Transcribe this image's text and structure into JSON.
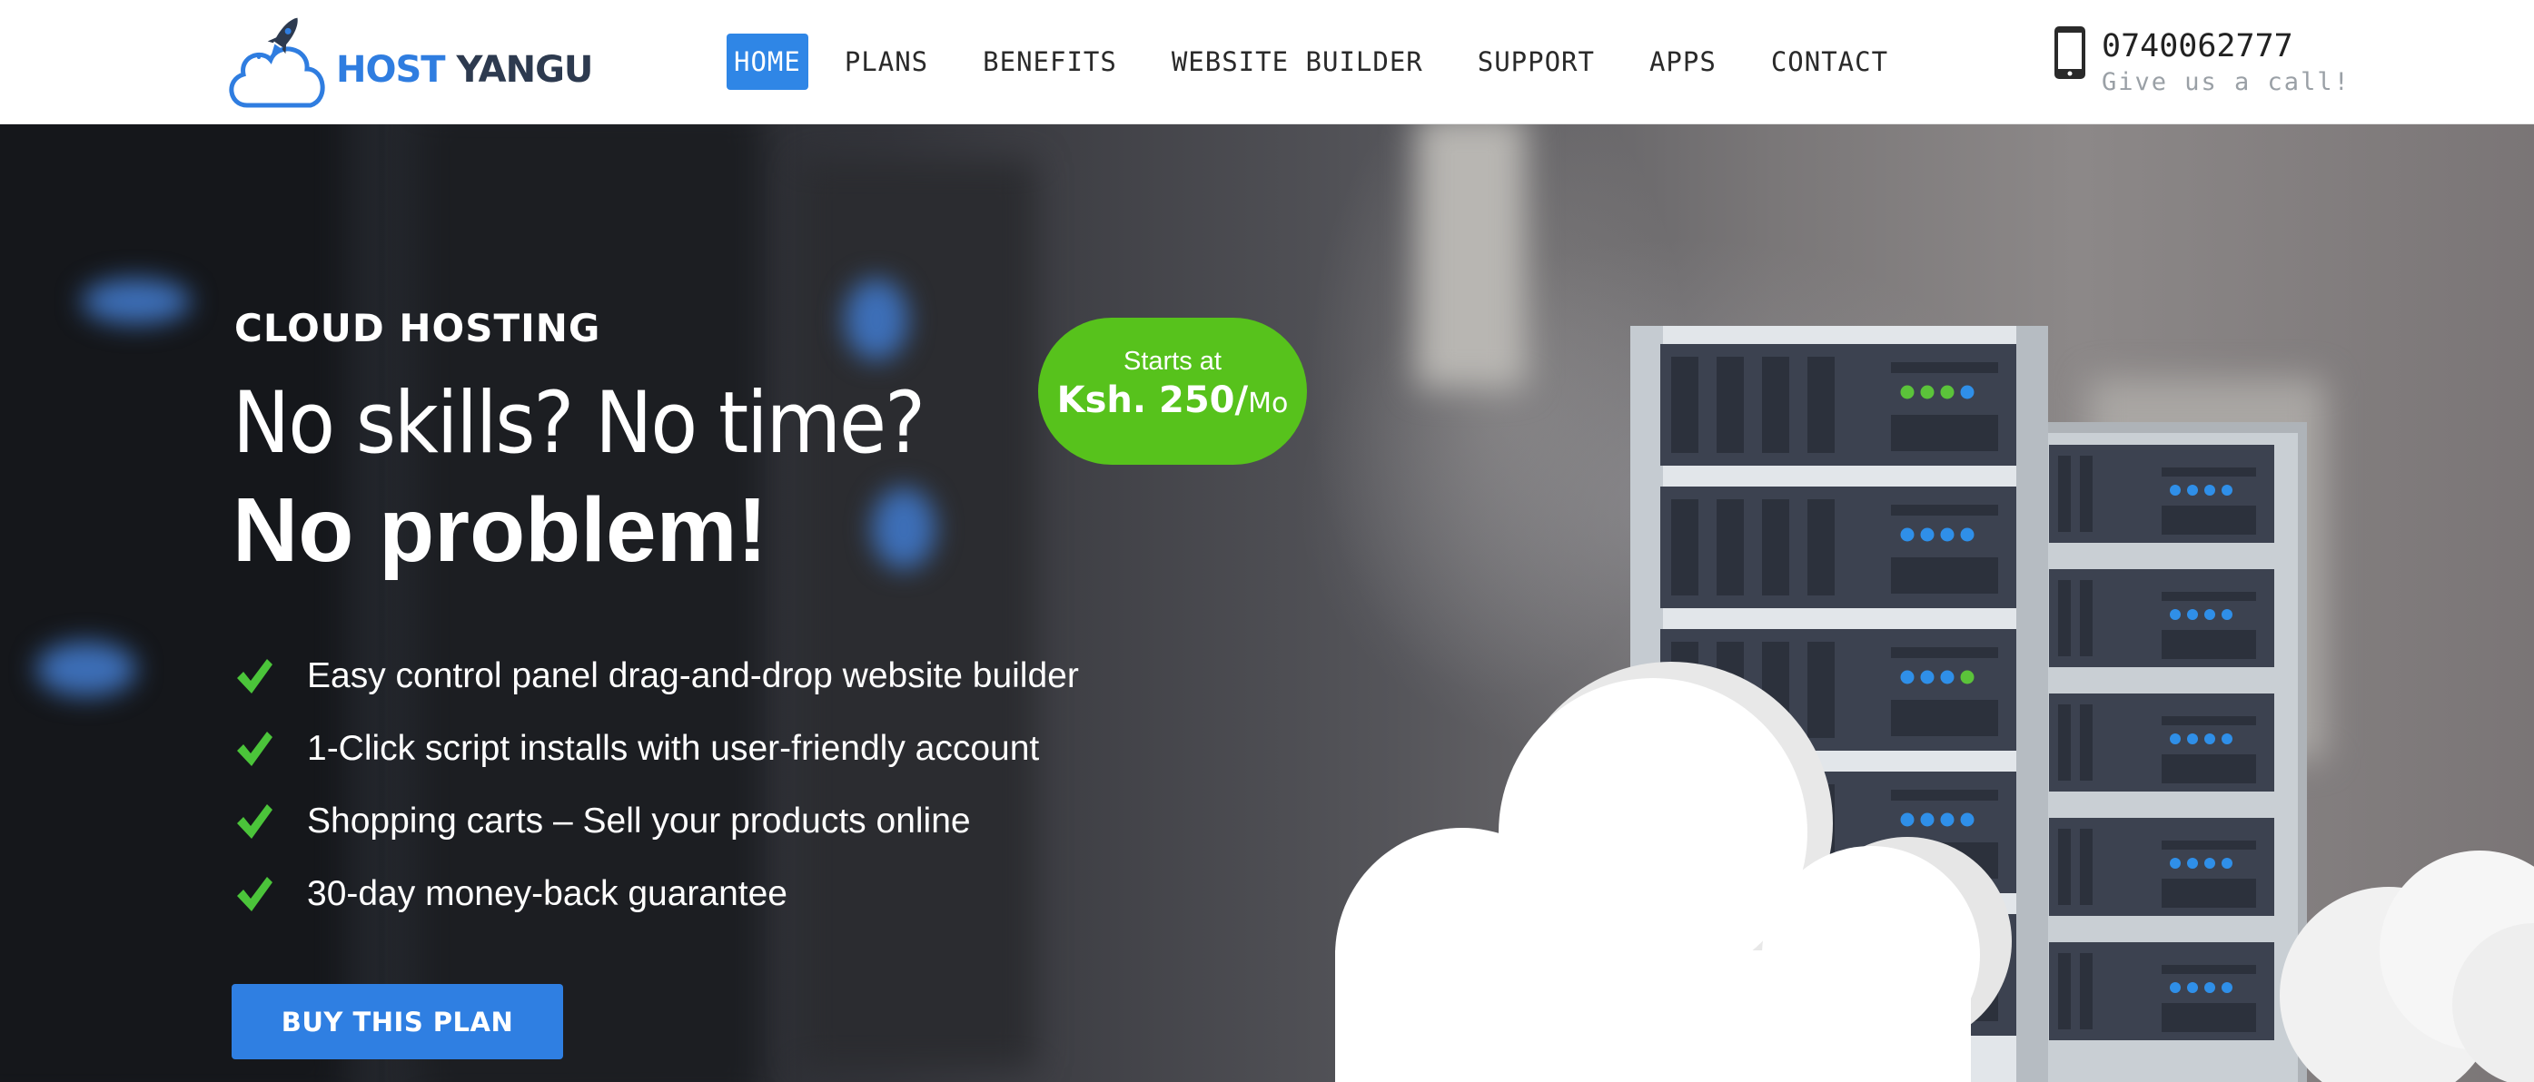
{
  "brand": {
    "word1": "HOST",
    "word2": "YANGU"
  },
  "nav": [
    {
      "label": "HOME",
      "active": true
    },
    {
      "label": "PLANS"
    },
    {
      "label": "BENEFITS"
    },
    {
      "label": "WEBSITE BUILDER"
    },
    {
      "label": "SUPPORT"
    },
    {
      "label": "APPS"
    },
    {
      "label": "CONTACT"
    }
  ],
  "contact": {
    "phone": "0740062777",
    "subtitle": "Give us a call!",
    "icon": "phone-icon"
  },
  "hero": {
    "eyebrow": "CLOUD HOSTING",
    "headline_line1": "No skills? No time?",
    "headline_line2": "No problem!",
    "features": [
      "Easy control panel drag-and-drop website builder",
      "1-Click script installs with user-friendly account",
      "Shopping carts – Sell your products online",
      "30-day money-back guarantee"
    ],
    "cta_label": "BUY THIS PLAN",
    "price": {
      "prefix": "Starts at",
      "amount": "Ksh. 250/",
      "period": "Mo"
    }
  },
  "colors": {
    "accent_blue": "#2f86e6",
    "price_green": "#57c21c",
    "check_green": "#4bc43a"
  }
}
